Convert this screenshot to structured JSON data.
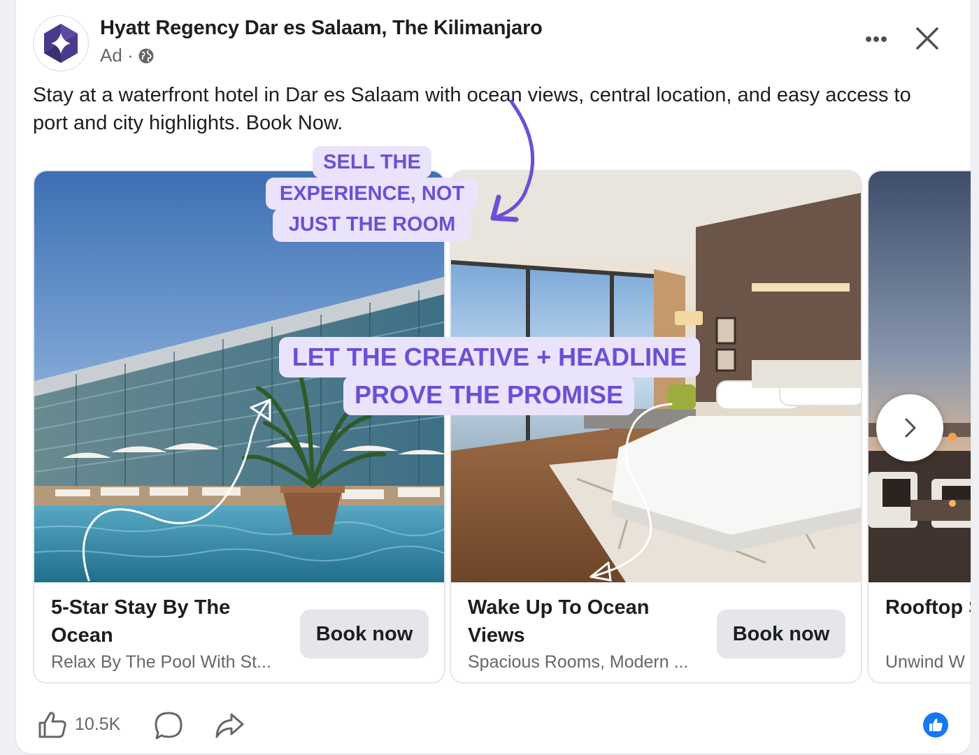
{
  "post": {
    "page_name": "Hyatt Regency Dar es Salaam, The Kilimanjaro",
    "sponsored_label": "Ad ·",
    "caption": "Stay at a waterfront hotel in Dar es Salaam with ocean views, central location, and easy access to port and city highlights. Book Now."
  },
  "annotations": {
    "callout_top_line1": "SELL THE",
    "callout_top_line2": "EXPERIENCE, NOT",
    "callout_top_line3": "JUST THE ROOM",
    "callout_mid_line1": "LET THE CREATIVE + HEADLINE",
    "callout_mid_line2": "PROVE THE PROMISE",
    "accent_color": "#6c4fd6",
    "callout_bg": "#e9e3fb"
  },
  "carousel": {
    "cards": [
      {
        "title": "5-Star Stay By The Ocean",
        "description": "Relax By The Pool With St...",
        "cta": "Book now"
      },
      {
        "title": "Wake Up To Ocean Views",
        "description": "Spacious Rooms, Modern ...",
        "cta": "Book now"
      },
      {
        "title": "Rooftop Sunset Vi",
        "description": "Unwind W",
        "cta": ""
      }
    ],
    "next_icon": "chevron-right-icon"
  },
  "footer": {
    "like_count": "10.5K",
    "icons": [
      "like-icon",
      "comment-icon",
      "share-icon",
      "like-reaction-icon"
    ],
    "reaction_color": "#1877f2"
  }
}
